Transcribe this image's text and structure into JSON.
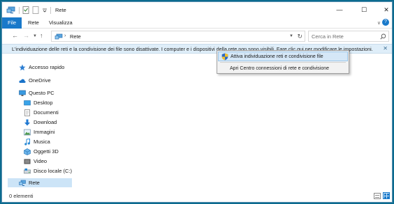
{
  "window": {
    "title": "Rete"
  },
  "ribbon": {
    "tabs": [
      {
        "label": "File"
      },
      {
        "label": "Rete"
      },
      {
        "label": "Visualizza"
      }
    ]
  },
  "address": {
    "crumb": "Rete"
  },
  "search": {
    "placeholder": "Cerca in Rete"
  },
  "infobar": {
    "message": "L'individuazione delle reti e la condivisione dei file sono disattivate. I computer e i dispositivi della rete non sono visibili. Fare clic qui per modificare le impostazioni."
  },
  "sidebar": {
    "items": [
      {
        "label": "Accesso rapido",
        "icon": "star-icon"
      },
      {
        "label": "OneDrive",
        "icon": "cloud-icon"
      },
      {
        "label": "Questo PC",
        "icon": "computer-icon"
      },
      {
        "label": "Desktop",
        "icon": "desktop-folder-icon"
      },
      {
        "label": "Documenti",
        "icon": "documents-icon"
      },
      {
        "label": "Download",
        "icon": "download-icon"
      },
      {
        "label": "Immagini",
        "icon": "pictures-icon"
      },
      {
        "label": "Musica",
        "icon": "music-icon"
      },
      {
        "label": "Oggetti 3D",
        "icon": "cube-icon"
      },
      {
        "label": "Video",
        "icon": "video-icon"
      },
      {
        "label": "Disco locale (C:)",
        "icon": "drive-icon"
      },
      {
        "label": "Rete",
        "icon": "network-icon"
      }
    ]
  },
  "status": {
    "count": "0 elementi"
  },
  "context_menu": {
    "items": [
      {
        "label": "Attiva individuazione reti e condivisione file",
        "icon": "shield-icon"
      },
      {
        "label": "Apri Centro connessioni di rete e condivisione"
      }
    ]
  },
  "colors": {
    "accent": "#1979ca",
    "infobar": "#dfeef9",
    "selection": "#cce4f7",
    "desktop": "#0b6b8f"
  }
}
